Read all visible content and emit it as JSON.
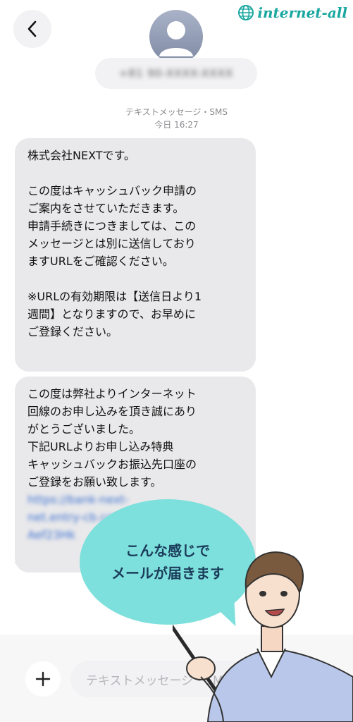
{
  "header": {
    "back_icon": "chevron-left-icon",
    "avatar_icon": "person-icon",
    "contact_number_blurred": "+81 90-XXXX-XXXX"
  },
  "brand": {
    "logo_icon": "globe-icon",
    "text": "internet-all",
    "color": "#19a7a0"
  },
  "thread_meta": {
    "channel": "テキストメッセージ・SMS",
    "timestamp": "今日 16:27"
  },
  "messages": [
    {
      "text": "株式会社NEXTです。\n\nこの度はキャッシュバック申請の\nご案内をさせていただきます。\n申請手続きにつきましては、この\nメッセージとは別に送信しており\nますURLをご確認ください。\n\n※URLの有効期限は【送信日より1\n週間】となりますので、お早めに\nご登録ください。"
    },
    {
      "text": "この度は弊社よりインターネット\n回線のお申し込みを頂き誠にあり\nがとうございました。\n下記URLよりお申し込み特典\nキャッシュバックお振込先口座の\nご登録をお願い致します。",
      "link_blurred": "https://bank-next-\nnet.entry-cb.com/\nAef23Hk"
    }
  ],
  "callout": {
    "line1": "こんな感じで",
    "line2": "メールが届きます",
    "color": "#7ee0dc"
  },
  "composer": {
    "add_icon": "plus-icon",
    "placeholder": "テキストメッセージ・SMS"
  }
}
